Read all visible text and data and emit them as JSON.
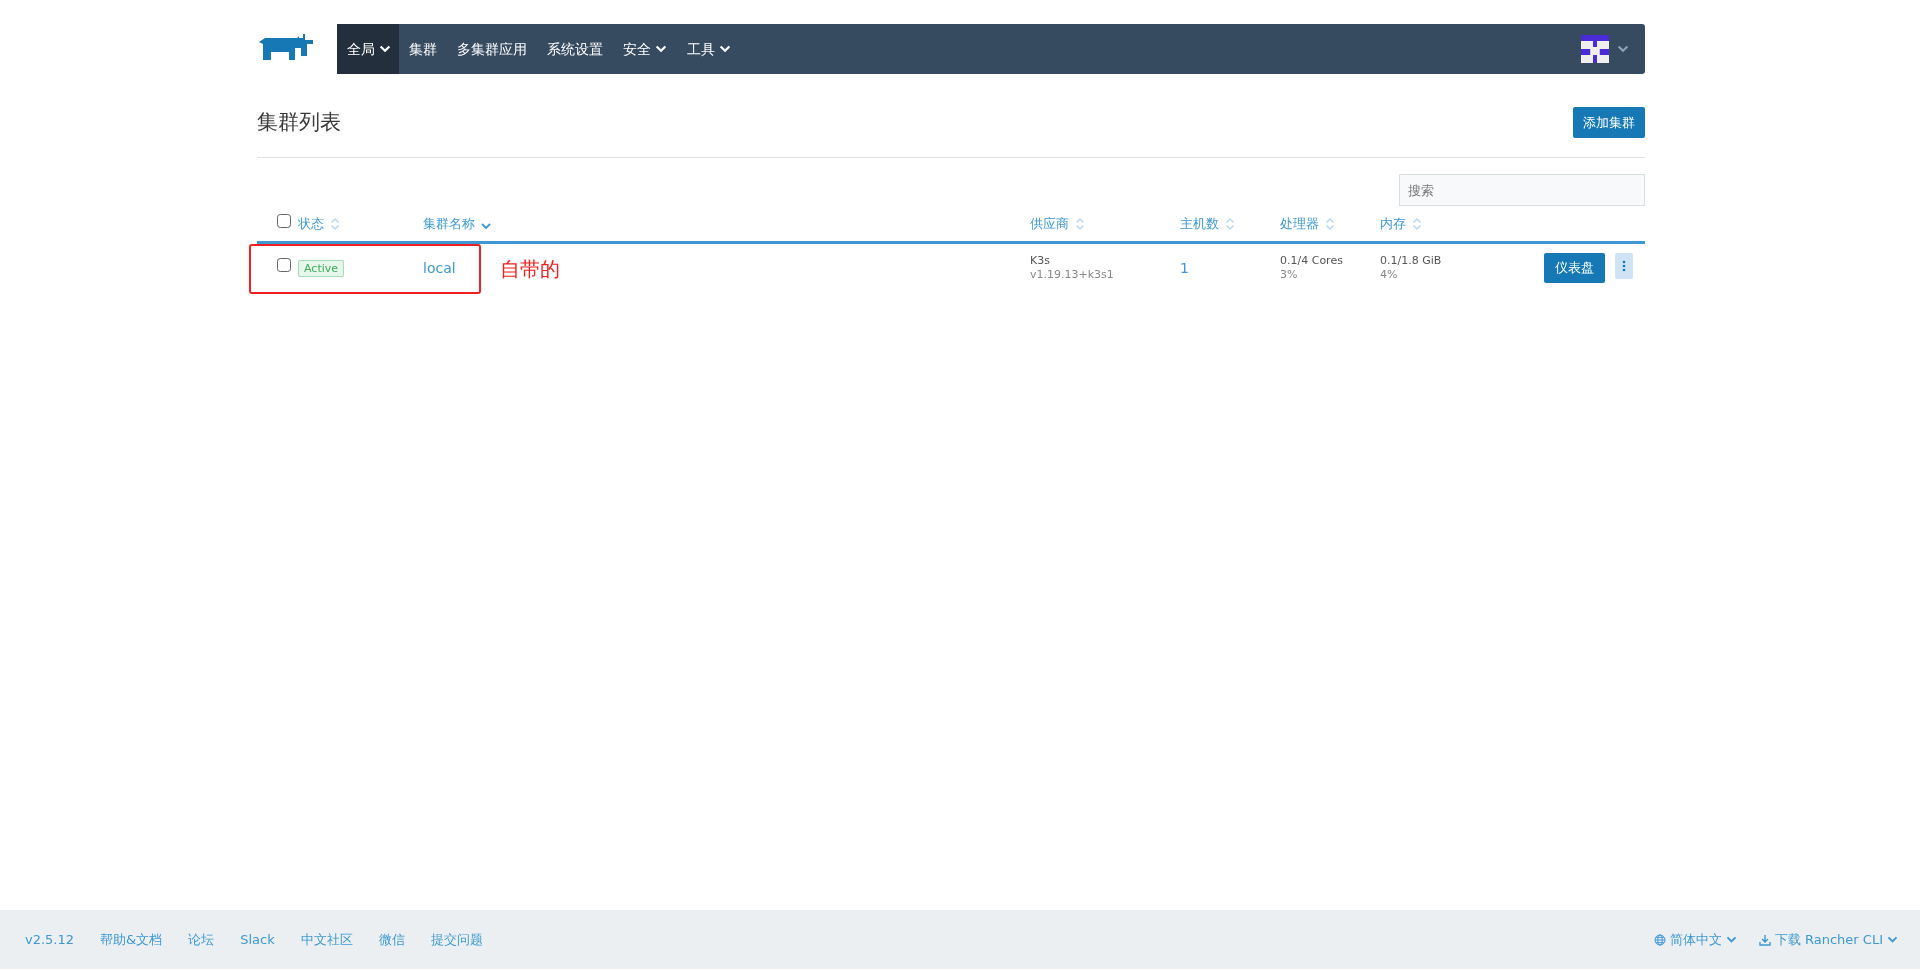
{
  "nav": {
    "items": [
      {
        "label": "全局",
        "dropdown": true,
        "selected": true
      },
      {
        "label": "集群",
        "dropdown": false,
        "selected": false
      },
      {
        "label": "多集群应用",
        "dropdown": false,
        "selected": false
      },
      {
        "label": "系统设置",
        "dropdown": false,
        "selected": false
      },
      {
        "label": "安全",
        "dropdown": true,
        "selected": false
      },
      {
        "label": "工具",
        "dropdown": true,
        "selected": false
      }
    ]
  },
  "page": {
    "title": "集群列表",
    "add_button": "添加集群",
    "search": {
      "placeholder": "搜索"
    }
  },
  "table": {
    "columns": [
      {
        "label": "状态",
        "sorted": false
      },
      {
        "label": "集群名称",
        "sorted": true
      },
      {
        "label": "供应商",
        "sorted": false
      },
      {
        "label": "主机数",
        "sorted": false
      },
      {
        "label": "处理器",
        "sorted": false
      },
      {
        "label": "内存",
        "sorted": false
      }
    ],
    "header_checked": false,
    "rows": [
      {
        "checked": false,
        "state": "Active",
        "name": "local",
        "provider": "K3s",
        "version": "v1.19.13+k3s1",
        "nodes": "1",
        "cpu": "0.1/4 Cores",
        "cpu_pct": "3%",
        "memory": "0.1/1.8 GiB",
        "memory_pct": "4%",
        "action": "仪表盘"
      }
    ]
  },
  "annotation": {
    "text": "自带的"
  },
  "footer": {
    "version": "v2.5.12",
    "links": [
      "帮助&文档",
      "论坛",
      "Slack",
      "中文社区",
      "微信",
      "提交问题"
    ],
    "language": "简体中文",
    "download": "下载 Rancher CLI"
  }
}
